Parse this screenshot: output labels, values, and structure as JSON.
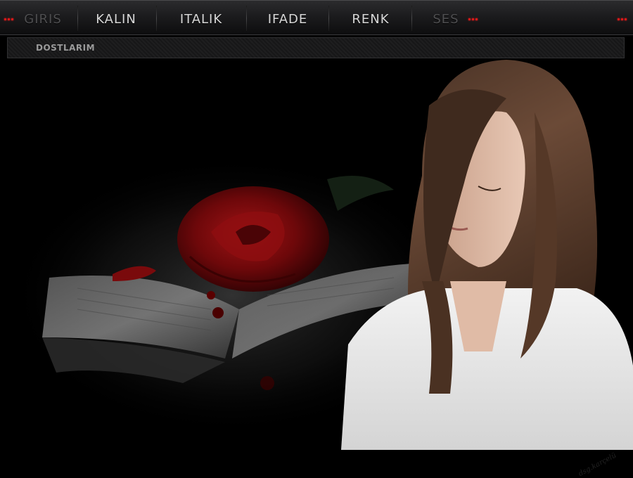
{
  "nav": {
    "items": [
      {
        "id": "giris",
        "label": "GIRIS",
        "dim": true
      },
      {
        "id": "kalin",
        "label": "KALIN",
        "dim": false
      },
      {
        "id": "italik",
        "label": "ITALIK",
        "dim": false
      },
      {
        "id": "ifade",
        "label": "IFADE",
        "dim": false
      },
      {
        "id": "renk",
        "label": "RENK",
        "dim": false
      },
      {
        "id": "ses",
        "label": "SES",
        "dim": true
      }
    ],
    "led_color": "#e01818"
  },
  "subbar": {
    "link_label": "DOSTLARIM"
  },
  "scene": {
    "signature": "dsg.karçelü",
    "elements": [
      "open-book-illustration",
      "red-rose-illustration",
      "woman-portrait"
    ]
  },
  "colors": {
    "background": "#000000",
    "nav_text": "#d8d8d8",
    "nav_text_dim": "#4e4e50",
    "rose": "#7a0a0c"
  }
}
